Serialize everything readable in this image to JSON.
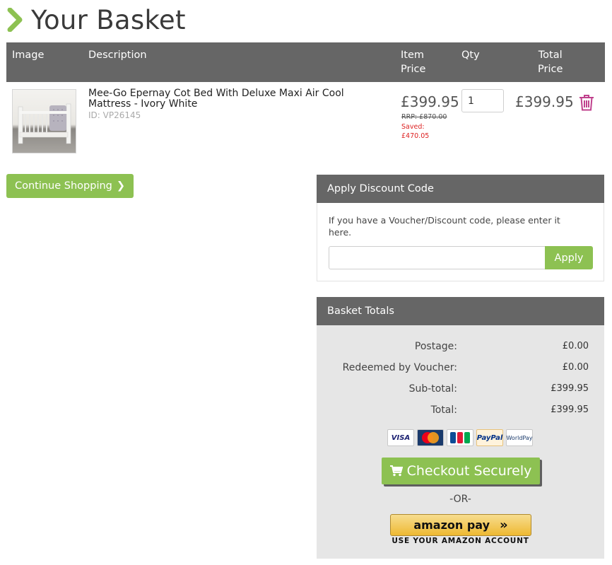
{
  "page": {
    "title": "Your Basket",
    "accent": "#8dc152",
    "header_bg": "#666666",
    "danger": "#d22222",
    "trash_color": "#c0418d"
  },
  "table": {
    "headers": {
      "image": "Image",
      "description": "Description",
      "item_price": "Item\nPrice",
      "qty": "Qty",
      "total_price": "Total\nPrice"
    },
    "rows": [
      {
        "name": "Mee-Go Epernay Cot Bed With Deluxe Maxi Air Cool Mattress - Ivory White",
        "id": "ID: VP26145",
        "price": "£399.95",
        "rrp": "RRP: £870.00",
        "saved": "Saved: £470.05",
        "qty": "1",
        "total": "£399.95"
      }
    ]
  },
  "continue_label": "Continue Shopping",
  "discount": {
    "heading": "Apply Discount Code",
    "text": "If you have a Voucher/Discount code, please enter it here.",
    "input_placeholder": "",
    "apply_label": "Apply"
  },
  "totals": {
    "heading": "Basket Totals",
    "lines": [
      {
        "label": "Postage:",
        "value": "£0.00"
      },
      {
        "label": "Redeemed by Voucher:",
        "value": "£0.00"
      },
      {
        "label": "Sub-total:",
        "value": "£399.95"
      },
      {
        "label": "Total:",
        "value": "£399.95"
      }
    ],
    "cards": [
      "VISA",
      "MasterCard",
      "JCB",
      "PayPal",
      "WorldPay"
    ],
    "checkout_label": "Checkout Securely",
    "or_label": "-OR-",
    "amazon_label": "amazon pay",
    "amazon_sub": "USE YOUR AMAZON ACCOUNT"
  }
}
